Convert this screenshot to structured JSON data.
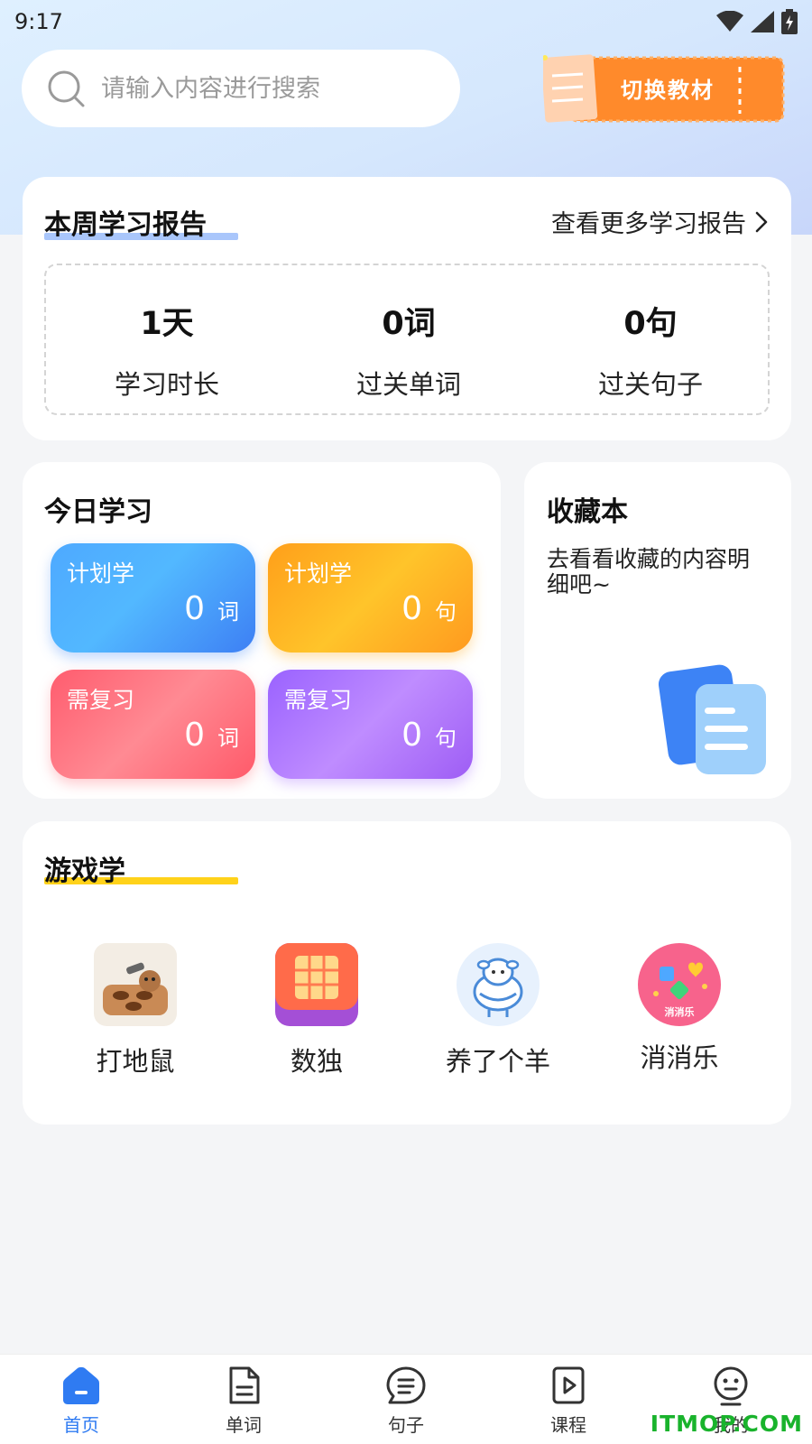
{
  "status_bar": {
    "time": "9:17"
  },
  "search": {
    "placeholder": "请输入内容进行搜索",
    "value": ""
  },
  "header": {
    "switch_textbook_label": "切换教材"
  },
  "report": {
    "title": "本周学习报告",
    "more_label": "查看更多学习报告",
    "stats": [
      {
        "value": "1天",
        "label": "学习时长"
      },
      {
        "value": "0词",
        "label": "过关单词"
      },
      {
        "value": "0句",
        "label": "过关句子"
      }
    ]
  },
  "today": {
    "title": "今日学习",
    "tiles": [
      {
        "label": "计划学",
        "value": "0",
        "unit": "词"
      },
      {
        "label": "计划学",
        "value": "0",
        "unit": "句"
      },
      {
        "label": "需复习",
        "value": "0",
        "unit": "词"
      },
      {
        "label": "需复习",
        "value": "0",
        "unit": "句"
      }
    ]
  },
  "favorites": {
    "title": "收藏本",
    "description": "去看看收藏的内容明细吧~"
  },
  "games": {
    "title": "游戏学",
    "items": [
      {
        "label": "打地鼠",
        "icon": "whack-a-mole-icon"
      },
      {
        "label": "数独",
        "icon": "sudoku-icon"
      },
      {
        "label": "养了个羊",
        "icon": "sheep-icon"
      },
      {
        "label": "消消乐",
        "icon": "match-game-icon",
        "badge": "消消乐"
      }
    ]
  },
  "bottom_nav": {
    "items": [
      {
        "label": "首页",
        "icon": "home-icon",
        "active": true
      },
      {
        "label": "单词",
        "icon": "document-icon",
        "active": false
      },
      {
        "label": "句子",
        "icon": "chat-icon",
        "active": false
      },
      {
        "label": "课程",
        "icon": "play-icon",
        "active": false
      },
      {
        "label": "我的",
        "icon": "profile-icon",
        "active": false
      }
    ]
  },
  "colors": {
    "accent": "#2f7bf2",
    "report_underline": "#a9c6fb",
    "games_underline": "#ffd21a",
    "tile_blue": "#4a8ff9",
    "tile_orange": "#ffad1f",
    "tile_red": "#ff6f7c",
    "tile_purple": "#a873ff"
  },
  "watermark": "ITMOP.COM"
}
